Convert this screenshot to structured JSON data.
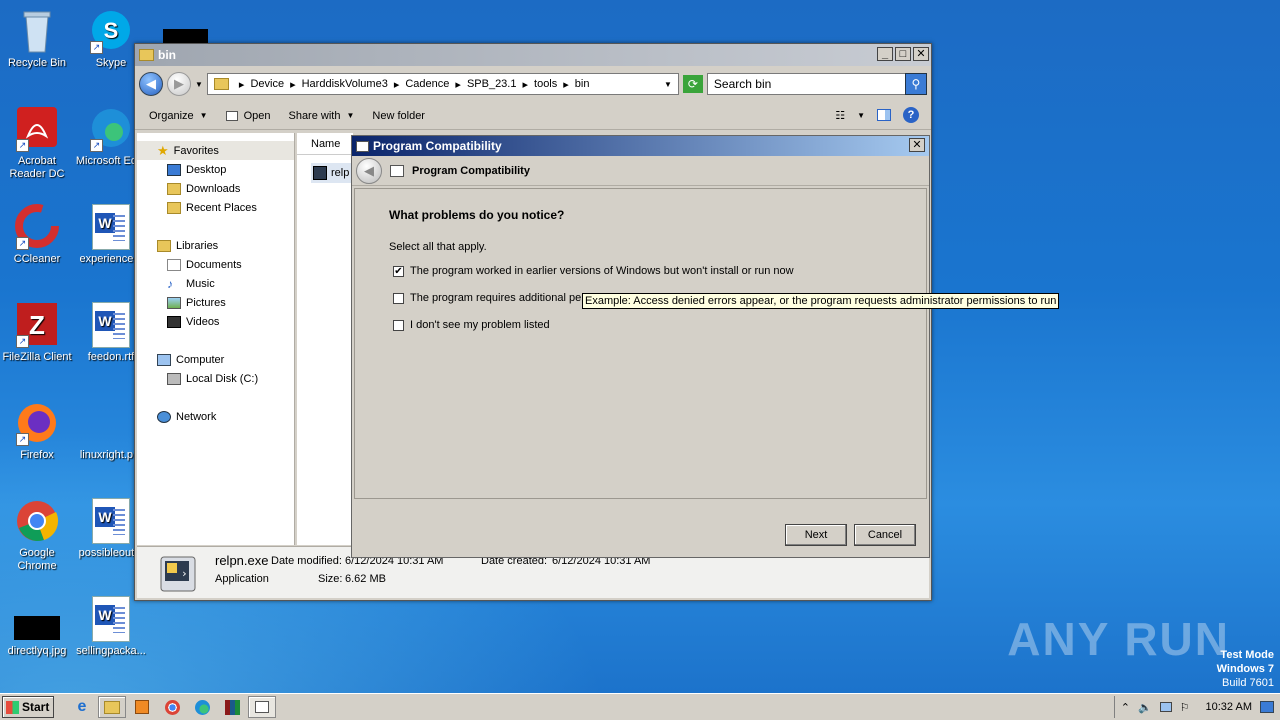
{
  "desktop": {
    "icons": [
      {
        "label": "Recycle Bin"
      },
      {
        "label": "Skype"
      },
      {
        "label": "Acrobat Reader DC"
      },
      {
        "label": "Microsoft Ed..."
      },
      {
        "label": "CCleaner"
      },
      {
        "label": "experience..."
      },
      {
        "label": "FileZilla Client"
      },
      {
        "label": "feedon.rtf"
      },
      {
        "label": "Firefox"
      },
      {
        "label": "linuxright.p..."
      },
      {
        "label": "Google Chrome"
      },
      {
        "label": "possibleout..."
      },
      {
        "label": "directlyq.jpg"
      },
      {
        "label": "sellingpacka..."
      }
    ],
    "watermark": "ANY RUN",
    "test_mode": {
      "line1": "Test Mode",
      "line2": "Windows 7",
      "line3": "Build 7601"
    }
  },
  "explorer": {
    "title": "bin",
    "breadcrumb": [
      "Device",
      "HarddiskVolume3",
      "Cadence",
      "SPB_23.1",
      "tools",
      "bin"
    ],
    "search_placeholder": "Search bin",
    "toolbar": {
      "organize": "Organize",
      "open": "Open",
      "share_with": "Share with",
      "new_folder": "New folder"
    },
    "nav": {
      "favorites": "Favorites",
      "favorites_items": [
        "Desktop",
        "Downloads",
        "Recent Places"
      ],
      "libraries": "Libraries",
      "libraries_items": [
        "Documents",
        "Music",
        "Pictures",
        "Videos"
      ],
      "computer": "Computer",
      "computer_items": [
        "Local Disk (C:)"
      ],
      "network": "Network"
    },
    "column_name": "Name",
    "file_partial": "relp",
    "details": {
      "filename": "relpn.exe",
      "modified_label": "Date modified:",
      "modified": "6/12/2024 10:31 AM",
      "created_label": "Date created:",
      "created": "6/12/2024 10:31 AM",
      "type": "Application",
      "size_label": "Size:",
      "size": "6.62 MB"
    }
  },
  "dialog": {
    "title": "Program Compatibility",
    "header": "Program Compatibility",
    "question": "What problems do you notice?",
    "instruction": "Select all that apply.",
    "options": [
      {
        "label": "The program worked in earlier versions of Windows but won't install or run now",
        "checked": true
      },
      {
        "label": "The program requires additional per",
        "checked": false
      },
      {
        "label": "I don't see my problem listed",
        "checked": false
      }
    ],
    "tooltip": "Example: Access denied errors appear, or the program requests administrator permissions to run",
    "next": "Next",
    "cancel": "Cancel"
  },
  "taskbar": {
    "start": "Start",
    "clock": "10:32 AM"
  }
}
